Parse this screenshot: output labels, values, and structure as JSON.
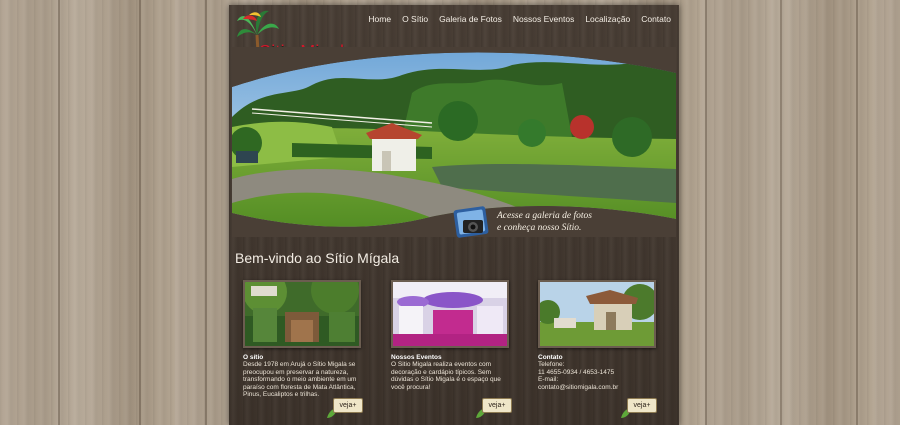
{
  "brand": {
    "name": "Sitio Migala"
  },
  "nav": [
    "Home",
    "O Sítio",
    "Galeria de Fotos",
    "Nossos Eventos",
    "Localização",
    "Contato"
  ],
  "hero": {
    "cta_line1": "Acesse a galeria de fotos",
    "cta_line2": "e conheça nosso Sítio."
  },
  "welcome": "Bem-vindo ao Sítio Mígala",
  "cards": [
    {
      "title": "O sítio",
      "body": "Desde 1978 em Arujá o Sítio Migala se preocupou em preservar a natureza, transformando o meio ambiente em um paraíso com floresta de Mata Atlântica, Pinus, Eucaliptos e trilhas.",
      "button": "veja"
    },
    {
      "title": "Nossos Eventos",
      "body": "O Sitio Migala realiza eventos com decoração e cardápio típicos. Sem dúvidas o Sítio Migala é o espaço que você procura!",
      "button": "veja"
    },
    {
      "title": "Contato",
      "lines": [
        "Telefone:",
        "11 4655-0934 / 4653-1475",
        "E-mail:",
        "contato@sitiomigala.com.br"
      ],
      "button": "veja"
    }
  ]
}
